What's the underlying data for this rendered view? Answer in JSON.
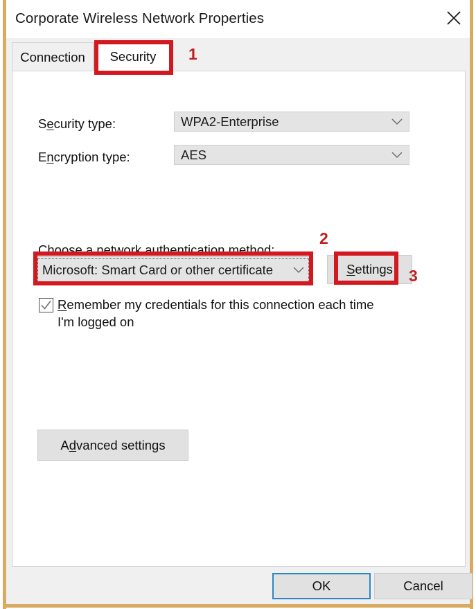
{
  "window": {
    "title": "Corporate Wireless Network Properties",
    "close_icon": "close-icon"
  },
  "tabs": [
    {
      "label": "Connection",
      "selected": false
    },
    {
      "label": "Security",
      "selected": true
    }
  ],
  "form": {
    "security_type": {
      "label_pre": "S",
      "label_acc": "e",
      "label_post": "curity type:",
      "value": "WPA2-Enterprise",
      "enabled": false
    },
    "encryption_type": {
      "label_pre": "E",
      "label_acc": "n",
      "label_post": "cryption type:",
      "value": "AES",
      "enabled": false
    },
    "auth_method": {
      "label": "Choose a network authentication method:",
      "value": "Microsoft: Smart Card or other certificate",
      "enabled": true
    },
    "settings_button": {
      "label_acc": "S",
      "label_post": "ettings"
    },
    "remember_checkbox": {
      "checked": true,
      "label_acc": "R",
      "label_post": "emember my credentials for this connection each time I'm logged on"
    },
    "advanced_button": {
      "label_pre": "A",
      "label_acc": "d",
      "label_post": "vanced settings"
    }
  },
  "footer": {
    "ok_label": "OK",
    "cancel_label": "Cancel"
  },
  "annotations": {
    "color": "#d31920",
    "steps": [
      {
        "number": "1",
        "target": "security-tab"
      },
      {
        "number": "2",
        "target": "auth-method-combo"
      },
      {
        "number": "3",
        "target": "settings-button"
      }
    ]
  }
}
